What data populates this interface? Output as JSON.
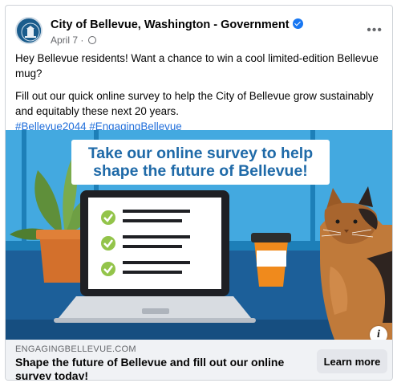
{
  "post": {
    "page_name": "City of Bellevue, Washington - Government",
    "date": "April 7",
    "separator": " · ",
    "more_label": "•••",
    "paragraphs": [
      "Hey Bellevue residents! Want a chance to win a cool limited-edition Bellevue mug?",
      "Fill out our quick online survey to help the City of Bellevue grow sustainably and equitably these next 20 years."
    ],
    "hashtags": [
      "#Bellevue2044",
      "#EngagingBellevue"
    ]
  },
  "image": {
    "headline_line1": "Take our online survey to help",
    "headline_line2": "shape the future of Bellevue!",
    "info_label": "i"
  },
  "link_preview": {
    "domain": "ENGAGINGBELLEVUE.COM",
    "title": "Shape the future of Bellevue and fill out our online survey today!",
    "cta_label": "Learn more"
  },
  "colors": {
    "brand_blue": "#1877f2",
    "hashtag_blue": "#216fdb",
    "headline_blue": "#1f6aa8",
    "check_green": "#93c44a",
    "cup_orange": "#f08a1c"
  }
}
